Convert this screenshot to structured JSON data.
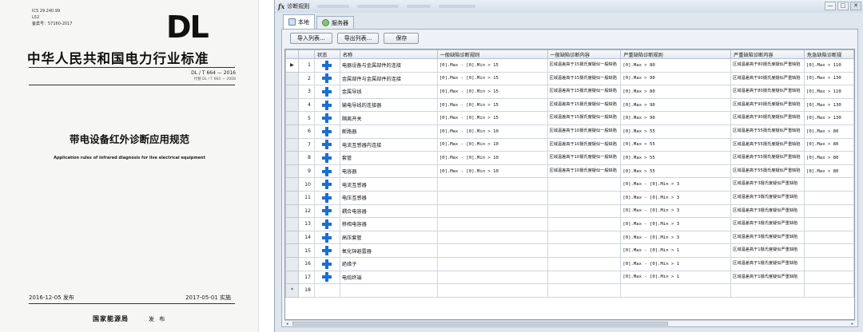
{
  "document": {
    "meta": [
      "ICS 29.240.99",
      "L52",
      "备案号：57160-2017"
    ],
    "logo": "DL",
    "title": "中华人民共和国电力行业标准",
    "code": "DL / T 664 — 2016",
    "replaces": "代替 DL / T 664 — 2008",
    "name": "带电设备红外诊断应用规范",
    "english": "Application rules of infrared diagnosis for live electrical equipment",
    "release_date": "2016-12-05 发布",
    "effective_date": "2017-05-01 实施",
    "publisher": "国家能源局",
    "publish_word": "发 布"
  },
  "window": {
    "icon": "fx",
    "title": "诊断规则",
    "controls": {
      "minimize": "—",
      "maximize": "□",
      "close": "✕"
    }
  },
  "tabs": [
    {
      "label": "本地",
      "icon": "document-icon",
      "active": true
    },
    {
      "label": "服务器",
      "icon": "server-icon",
      "active": false
    }
  ],
  "toolbar": {
    "import_label": "导入列表...",
    "export_label": "导出列表...",
    "save_label": "保存"
  },
  "grid": {
    "columns": [
      "",
      "",
      "状态",
      "名称",
      "一般缺陷诊断规则",
      "一般缺陷诊断内容",
      "严重缺陷诊断规则",
      "严重缺陷诊断内容",
      "危急缺陷诊断规"
    ],
    "rows": [
      {
        "num": "1",
        "name": "电器设备与金属部件的连接",
        "general_rule": "[0].Max - [0].Min > 15",
        "general_content": "区域温差高于15摄氏度疑似一般缺陷",
        "serious_rule": "[0].Max > 80",
        "serious_content": "区域温差高于80摄氏度疑似严重缺陷",
        "critical_rule": "[0].Max > 110"
      },
      {
        "num": "2",
        "name": "金属部件与金属部件的连接",
        "general_rule": "[0].Max - [0].Min > 15",
        "general_content": "区域温差高于15摄氏度疑似一般缺陷",
        "serious_rule": "[0].Max > 90",
        "serious_content": "区域温差高于90摄氏度疑似严重缺陷",
        "critical_rule": "[0].Max > 130"
      },
      {
        "num": "3",
        "name": "金属导线",
        "general_rule": "[0].Max - [0].Min > 15",
        "general_content": "区域温差高于15摄氏度疑似一般缺陷",
        "serious_rule": "[0].Max > 80",
        "serious_content": "区域温差高于80摄氏度疑似严重缺陷",
        "critical_rule": "[0].Max > 110"
      },
      {
        "num": "4",
        "name": "输电导线的连接器",
        "general_rule": "[0].Max - [0].Min > 15",
        "general_content": "区域温差高于15摄氏度疑似一般缺陷",
        "serious_rule": "[0].Max > 90",
        "serious_content": "区域温差高于90摄氏度疑似严重缺陷",
        "critical_rule": "[0].Max > 130"
      },
      {
        "num": "5",
        "name": "隔离开关",
        "general_rule": "[0].Max - [0].Min > 15",
        "general_content": "区域温差高于15摄氏度疑似一般缺陷",
        "serious_rule": "[0].Max > 90",
        "serious_content": "区域温差高于90摄氏度疑似严重缺陷",
        "critical_rule": "[0].Max > 130"
      },
      {
        "num": "6",
        "name": "断路器",
        "general_rule": "[0].Max - [0].Min > 10",
        "general_content": "区域温差高于10摄氏度疑似一般缺陷",
        "serious_rule": "[0].Max > 55",
        "serious_content": "区域温差高于55摄氏度疑似严重缺陷",
        "critical_rule": "[0].Max > 80"
      },
      {
        "num": "7",
        "name": "电流互感器内连接",
        "general_rule": "[0].Max - [0].Min > 10",
        "general_content": "区域温差高于10摄氏度疑似一般缺陷",
        "serious_rule": "[0].Max > 55",
        "serious_content": "区域温差高于55摄氏度疑似严重缺陷",
        "critical_rule": "[0].Max > 80"
      },
      {
        "num": "8",
        "name": "套管",
        "general_rule": "[0].Max - [0].Min > 10",
        "general_content": "区域温差高于10摄氏度疑似一般缺陷",
        "serious_rule": "[0].Max > 55",
        "serious_content": "区域温差高于55摄氏度疑似严重缺陷",
        "critical_rule": "[0].Max > 80"
      },
      {
        "num": "9",
        "name": "电容器",
        "general_rule": "[0].Max - [0].Min > 10",
        "general_content": "区域温差高于10摄氏度疑似一般缺陷",
        "serious_rule": "[0].Max > 55",
        "serious_content": "区域温差高于55摄氏度疑似严重缺陷",
        "critical_rule": "[0].Max > 80"
      },
      {
        "num": "10",
        "name": "电流互感器",
        "general_rule": "",
        "general_content": "",
        "serious_rule": "[0].Max - [0].Min > 3",
        "serious_content": "区域温差高于3摄氏度疑似严重缺陷",
        "critical_rule": ""
      },
      {
        "num": "11",
        "name": "电压互感器",
        "general_rule": "",
        "general_content": "",
        "serious_rule": "[0].Max - [0].Min > 3",
        "serious_content": "区域温差高于3摄氏度疑似严重缺陷",
        "critical_rule": ""
      },
      {
        "num": "12",
        "name": "耦合电容器",
        "general_rule": "",
        "general_content": "",
        "serious_rule": "[0].Max - [0].Min > 3",
        "serious_content": "区域温差高于3摄氏度疑似严重缺陷",
        "critical_rule": ""
      },
      {
        "num": "13",
        "name": "移相电容器",
        "general_rule": "",
        "general_content": "",
        "serious_rule": "[0].Max - [0].Min > 3",
        "serious_content": "区域温差高于3摄氏度疑似严重缺陷",
        "critical_rule": ""
      },
      {
        "num": "14",
        "name": "高压套管",
        "general_rule": "",
        "general_content": "",
        "serious_rule": "[0].Max - [0].Min > 3",
        "serious_content": "区域温差高于3摄氏度疑似严重缺陷",
        "critical_rule": ""
      },
      {
        "num": "15",
        "name": "氧化锌避雷器",
        "general_rule": "",
        "general_content": "",
        "serious_rule": "[0].Max - [0].Min > 1",
        "serious_content": "区域温差高于1摄氏度疑似严重缺陷",
        "critical_rule": ""
      },
      {
        "num": "16",
        "name": "绝缘子",
        "general_rule": "",
        "general_content": "",
        "serious_rule": "[0].Max - [0].Min > 1",
        "serious_content": "区域温差高于1摄氏度疑似严重缺陷",
        "critical_rule": ""
      },
      {
        "num": "17",
        "name": "电缆终端",
        "general_rule": "",
        "general_content": "",
        "serious_rule": "[0].Max - [0].Min > 1",
        "serious_content": "区域温差高于1摄氏度疑似严重缺陷",
        "critical_rule": ""
      }
    ],
    "new_row": {
      "marker": "*",
      "num": "18"
    },
    "current_row_marker": "▶"
  },
  "scrollbar": {
    "left": "◂",
    "right": "▸"
  }
}
